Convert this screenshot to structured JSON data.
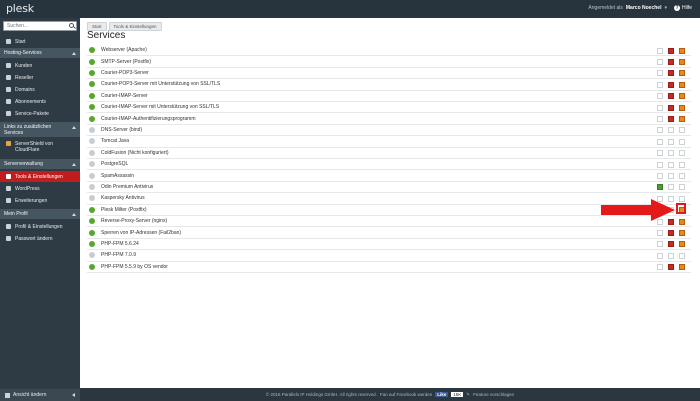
{
  "app": {
    "logo": "plesk"
  },
  "topbar": {
    "logged_in_label": "Angemeldet als",
    "user": "Marco Noechel",
    "help": "Hilfe"
  },
  "sidebar": {
    "search_placeholder": "Suchen...",
    "start": "Start",
    "groups": [
      {
        "title": "Hosting-Services",
        "items": [
          "Kunden",
          "Reseller",
          "Domains",
          "Abonnements",
          "Service-Pakete"
        ]
      },
      {
        "title": "Links zu zusätzlichen Services",
        "items": [
          "ServerShield von CloudFlare"
        ]
      },
      {
        "title": "Serververwaltung",
        "items": [
          "Tools & Einstellungen",
          "WordPress",
          "Erweiterungen"
        ]
      },
      {
        "title": "Mein Profil",
        "items": [
          "Profil & Einstellungen",
          "Passwort ändern"
        ]
      }
    ],
    "footer": "Ansicht ändern"
  },
  "main": {
    "breadcrumb": [
      "Start",
      "Tools & Einstellungen"
    ],
    "title": "Services",
    "services": [
      {
        "name": "Webserver (Apache)",
        "status": "ok",
        "controls": [
          "none",
          "stop",
          "restart"
        ]
      },
      {
        "name": "SMTP-Server (Postfix)",
        "status": "ok",
        "controls": [
          "none",
          "stop",
          "restart"
        ]
      },
      {
        "name": "Courier-POP3-Server",
        "status": "ok",
        "controls": [
          "none",
          "stop",
          "restart"
        ]
      },
      {
        "name": "Courier-POP3-Server mit Unterstützung von SSL/TLS",
        "status": "ok",
        "controls": [
          "none",
          "stop",
          "restart"
        ]
      },
      {
        "name": "Courier-IMAP-Server",
        "status": "ok",
        "controls": [
          "none",
          "stop",
          "restart"
        ]
      },
      {
        "name": "Courier-IMAP-Server mit Unterstützung von SSL/TLS",
        "status": "ok",
        "controls": [
          "none",
          "stop",
          "restart"
        ]
      },
      {
        "name": "Courier-IMAP-Authentifizierungsprogramm",
        "status": "ok",
        "controls": [
          "none",
          "stop",
          "restart"
        ]
      },
      {
        "name": "DNS-Server (bind)",
        "status": "off",
        "controls": [
          "none",
          "none",
          "none"
        ]
      },
      {
        "name": "Tomcat Java",
        "status": "off",
        "controls": [
          "none",
          "none",
          "none"
        ]
      },
      {
        "name": "ColdFusion (Nicht konfiguriert)",
        "status": "off",
        "controls": [
          "none",
          "none",
          "none"
        ]
      },
      {
        "name": "PostgreSQL",
        "status": "off",
        "controls": [
          "none",
          "none",
          "none"
        ]
      },
      {
        "name": "SpamAssassin",
        "status": "off",
        "controls": [
          "none",
          "none",
          "none"
        ]
      },
      {
        "name": "Odin Premium Antivirus",
        "status": "off",
        "controls": [
          "go",
          "none",
          "none"
        ]
      },
      {
        "name": "Kaspersky Antivirus",
        "status": "off",
        "controls": [
          "none",
          "none",
          "none"
        ]
      },
      {
        "name": "Plesk Milter (Postfix)",
        "status": "ok",
        "controls": [
          "none",
          "none",
          "restart"
        ]
      },
      {
        "name": "Reverse-Proxy-Server (nginx)",
        "status": "ok",
        "controls": [
          "none",
          "stop",
          "restart"
        ]
      },
      {
        "name": "Sperren von IP-Adressen (Fail2ban)",
        "status": "ok",
        "controls": [
          "none",
          "stop",
          "restart"
        ]
      },
      {
        "name": "PHP-FPM 5.6.24",
        "status": "ok",
        "controls": [
          "none",
          "stop",
          "restart"
        ]
      },
      {
        "name": "PHP-FPM 7.0.9",
        "status": "off",
        "controls": [
          "none",
          "none",
          "none"
        ]
      },
      {
        "name": "PHP-FPM 5.5.9 by OS vendor",
        "status": "ok",
        "controls": [
          "none",
          "stop",
          "restart"
        ]
      }
    ]
  },
  "footer": {
    "copyright": "© 2016 Parallels IP Holdings GmbH. All rights reserved.",
    "facebook_text": "Fan auf Facebook werden",
    "like": "Like",
    "like_count": "15K",
    "suggest": "Feature vorschlagen"
  },
  "colors": {
    "accent": "#c21d1e",
    "ok": "#56a82d",
    "stop": "#c32b27",
    "restart": "#e48b1d"
  }
}
